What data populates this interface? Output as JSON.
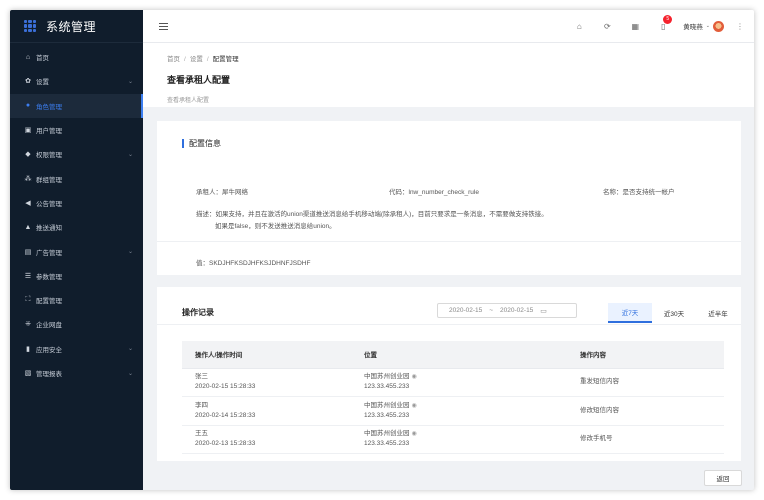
{
  "app": {
    "title": "系统管理"
  },
  "sidebar": {
    "items": [
      {
        "label": "首页",
        "icon": "home-icon",
        "glyph": "⌂",
        "arrow": ""
      },
      {
        "label": "设置",
        "icon": "gear-icon",
        "glyph": "✿",
        "arrow": "⌄"
      },
      {
        "label": "角色管理",
        "icon": "user-circle-icon",
        "glyph": "●",
        "arrow": ""
      },
      {
        "label": "用户管理",
        "icon": "id-card-icon",
        "glyph": "▣",
        "arrow": ""
      },
      {
        "label": "权限管理",
        "icon": "shield-icon",
        "glyph": "◆",
        "arrow": "⌄"
      },
      {
        "label": "群组管理",
        "icon": "group-icon",
        "glyph": "⁂",
        "arrow": ""
      },
      {
        "label": "公告管理",
        "icon": "megaphone-icon",
        "glyph": "◀",
        "arrow": ""
      },
      {
        "label": "推送通知",
        "icon": "bell-icon",
        "glyph": "▲",
        "arrow": ""
      },
      {
        "label": "广告管理",
        "icon": "ad-icon",
        "glyph": "▤",
        "arrow": "⌄"
      },
      {
        "label": "参数管理",
        "icon": "list-icon",
        "glyph": "☰",
        "arrow": ""
      },
      {
        "label": "配置管理",
        "icon": "config-icon",
        "glyph": "⛶",
        "arrow": ""
      },
      {
        "label": "企业网盘",
        "icon": "grid-icon",
        "glyph": "⁜",
        "arrow": ""
      },
      {
        "label": "应用安全",
        "icon": "lock-icon",
        "glyph": "▮",
        "arrow": "⌄"
      },
      {
        "label": "管理报表",
        "icon": "report-icon",
        "glyph": "▧",
        "arrow": "⌄"
      }
    ]
  },
  "header": {
    "notification_count": "5",
    "user_name": "黄晓燕"
  },
  "page": {
    "breadcrumb": [
      "首页",
      "设置",
      "配置管理"
    ],
    "title": "查看承租人配置",
    "subtitle": "查看承租人配置"
  },
  "config": {
    "title": "配置信息",
    "tenant": "承租人：犀牛网络",
    "code": "代码：lnw_number_check_rule",
    "name": "名称：是否支持统一帐户",
    "desc_line1": "描述：如果支持，并且在激活的union渠道推送消息给手机移动端(除承租人)，目前只要求是一条消息，不需要做支持铁接。",
    "desc_line2": "如果是false，则不发送推送消息给union。",
    "value": "值：SKDJHFKSDJHFKSJDHNFJSDHF"
  },
  "records": {
    "title": "操作记录",
    "date_start": "2020-02-15",
    "date_end": "2020-02-15",
    "tabs": [
      "近7天",
      "近30天",
      "近半年"
    ],
    "active_tab": 0,
    "columns": [
      "操作人/操作时间",
      "位置",
      "操作内容"
    ],
    "rows": [
      {
        "user": "张三",
        "time": "2020-02-15 15:28:33",
        "place": "中国苏州创业园",
        "ip": "123.33.455.233",
        "action": "重发短信内容"
      },
      {
        "user": "李四",
        "time": "2020-02-14 15:28:33",
        "place": "中国苏州创业园",
        "ip": "123.33.455.233",
        "action": "修改短信内容"
      },
      {
        "user": "王五",
        "time": "2020-02-13 15:28:33",
        "place": "中国苏州创业园",
        "ip": "123.33.455.233",
        "action": "修改手机号"
      }
    ]
  },
  "footer": {
    "back_label": "返回"
  },
  "colors": {
    "sidebar_bg": "#101d2c",
    "accent": "#2f6fde",
    "badge": "#f5222d"
  }
}
